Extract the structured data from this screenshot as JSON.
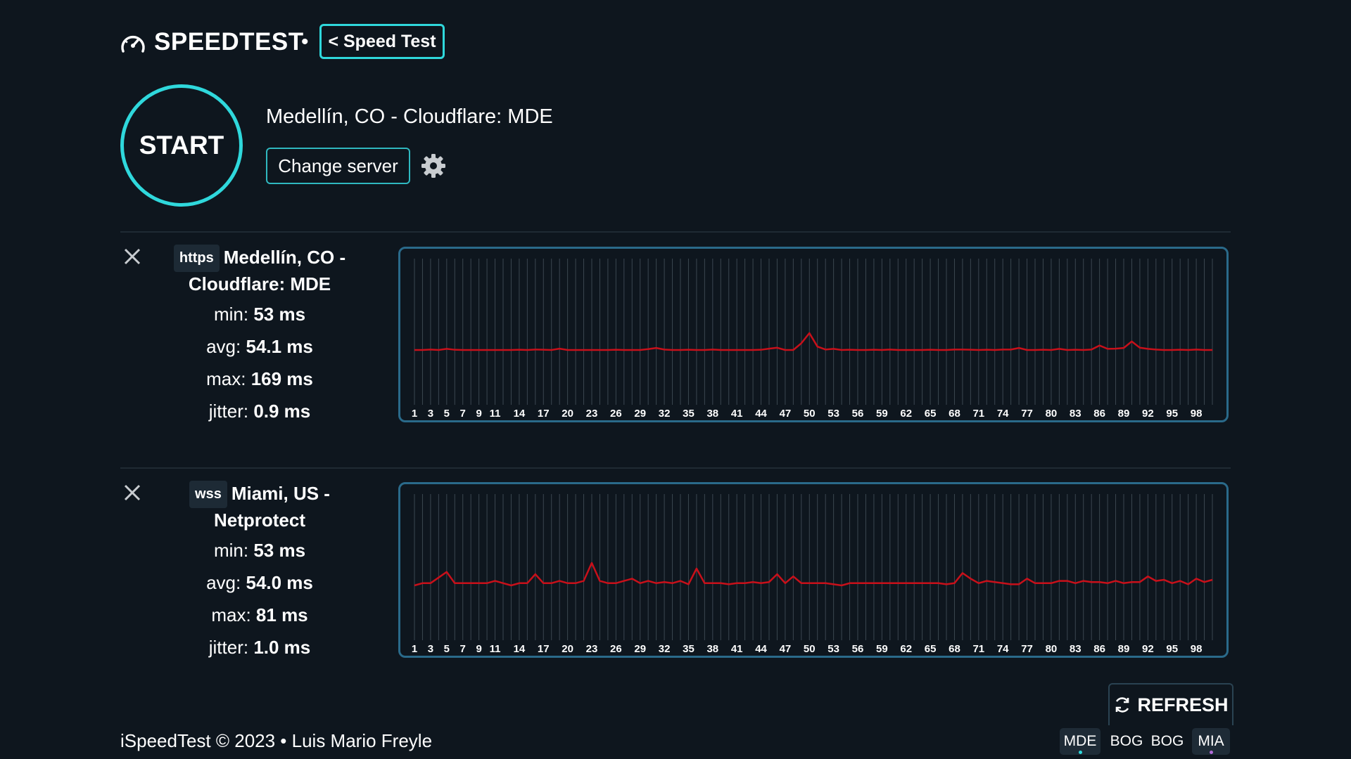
{
  "header": {
    "logo_text": "SPEEDTEST",
    "separator": "•",
    "back_button": "< Speed Test"
  },
  "start": {
    "label": "START",
    "server_name": "Medellín, CO - Cloudflare: MDE",
    "change_server": "Change server"
  },
  "results": [
    {
      "protocol": "https",
      "title": "Medellín, CO - Cloudflare: MDE",
      "title_line1": "Medellín, CO -",
      "title_line2": "Cloudflare: MDE",
      "min_label": "min:",
      "min_value": "53 ms",
      "avg_label": "avg:",
      "avg_value": "54.1 ms",
      "max_label": "max:",
      "max_value": "169 ms",
      "jitter_label": "jitter:",
      "jitter_value": "0.9 ms"
    },
    {
      "protocol": "wss",
      "title": "Miami, US - Netprotect",
      "title_line1": "Miami, US -",
      "title_line2": "Netprotect",
      "min_label": "min:",
      "min_value": "53 ms",
      "avg_label": "avg:",
      "avg_value": "54.0 ms",
      "max_label": "max:",
      "max_value": "81 ms",
      "jitter_label": "jitter:",
      "jitter_value": "1.0 ms"
    }
  ],
  "chart_data": [
    {
      "type": "line",
      "x_tick_labels": [
        "1",
        "3",
        "5",
        "7",
        "9",
        "11",
        "14",
        "17",
        "20",
        "23",
        "26",
        "29",
        "32",
        "35",
        "38",
        "41",
        "44",
        "47",
        "50",
        "53",
        "56",
        "59",
        "62",
        "65",
        "68",
        "71",
        "74",
        "77",
        "80",
        "83",
        "86",
        "89",
        "92",
        "95",
        "98"
      ],
      "x": [
        1,
        2,
        3,
        4,
        5,
        6,
        7,
        8,
        9,
        10,
        11,
        12,
        13,
        14,
        15,
        16,
        17,
        18,
        19,
        20,
        21,
        22,
        23,
        24,
        25,
        26,
        27,
        28,
        29,
        30,
        31,
        32,
        33,
        34,
        35,
        36,
        37,
        38,
        39,
        40,
        41,
        42,
        43,
        44,
        45,
        46,
        47,
        48,
        49,
        50,
        51,
        52,
        53,
        54,
        55,
        56,
        57,
        58,
        59,
        60,
        61,
        62,
        63,
        64,
        65,
        66,
        67,
        68,
        69,
        70,
        71,
        72,
        73,
        74,
        75,
        76,
        77,
        78,
        79,
        80,
        81,
        82,
        83,
        84,
        85,
        86,
        87,
        88,
        89,
        90,
        91,
        92,
        93,
        94,
        95,
        96,
        97,
        98,
        99,
        100
      ],
      "series": [
        {
          "color": "#c8101a",
          "values": [
            53,
            53,
            53.2,
            53,
            53.5,
            53.1,
            53,
            53,
            53,
            53,
            53,
            53,
            53,
            53.1,
            53,
            53.2,
            53.1,
            53,
            53.6,
            53,
            53,
            53,
            53,
            53,
            53,
            53.1,
            53,
            53,
            53,
            53.4,
            53.9,
            53.2,
            53,
            53,
            53.1,
            53,
            53,
            53.2,
            53,
            53,
            53,
            53,
            53,
            53.1,
            53.6,
            54,
            53,
            53,
            56,
            60.5,
            54.5,
            53.2,
            53.5,
            53,
            53.1,
            53,
            53,
            53.1,
            53,
            53.2,
            53,
            53,
            53,
            53,
            53.1,
            53,
            53,
            53.2,
            53.2,
            53.1,
            53,
            53.1,
            53,
            53.2,
            53.2,
            53.9,
            53,
            53,
            53.1,
            53,
            53.5,
            53,
            53.1,
            53,
            53.2,
            55,
            53.5,
            53.6,
            53.9,
            56.8,
            54,
            53.5,
            53.2,
            53,
            53,
            53.1,
            53,
            53.2,
            53,
            53
          ]
        }
      ]
    },
    {
      "type": "line",
      "x_tick_labels": [
        "1",
        "3",
        "5",
        "7",
        "9",
        "11",
        "14",
        "17",
        "20",
        "23",
        "26",
        "29",
        "32",
        "35",
        "38",
        "41",
        "44",
        "47",
        "50",
        "53",
        "56",
        "59",
        "62",
        "65",
        "68",
        "71",
        "74",
        "77",
        "80",
        "83",
        "86",
        "89",
        "92",
        "95",
        "98"
      ],
      "x": [
        1,
        2,
        3,
        4,
        5,
        6,
        7,
        8,
        9,
        10,
        11,
        12,
        13,
        14,
        15,
        16,
        17,
        18,
        19,
        20,
        21,
        22,
        23,
        24,
        25,
        26,
        27,
        28,
        29,
        30,
        31,
        32,
        33,
        34,
        35,
        36,
        37,
        38,
        39,
        40,
        41,
        42,
        43,
        44,
        45,
        46,
        47,
        48,
        49,
        50,
        51,
        52,
        53,
        54,
        55,
        56,
        57,
        58,
        59,
        60,
        61,
        62,
        63,
        64,
        65,
        66,
        67,
        68,
        69,
        70,
        71,
        72,
        73,
        74,
        75,
        76,
        77,
        78,
        79,
        80,
        81,
        82,
        83,
        84,
        85,
        86,
        87,
        88,
        89,
        90,
        91,
        92,
        93,
        94,
        95,
        96,
        97,
        98,
        99,
        100
      ],
      "series": [
        {
          "color": "#c8101a",
          "values": [
            53,
            54,
            54,
            56.5,
            59,
            54,
            54,
            54,
            54,
            54,
            55,
            54,
            53,
            54,
            54,
            58,
            54,
            54,
            55,
            54,
            54,
            55,
            63,
            55,
            54,
            54,
            55,
            56,
            54,
            55,
            54,
            54.5,
            54,
            55,
            53.5,
            60.5,
            54,
            54,
            54,
            53.5,
            54,
            54,
            54.5,
            54,
            54.5,
            58,
            54,
            57,
            54,
            54,
            54,
            54,
            53.5,
            53,
            54,
            54,
            54,
            54,
            54,
            54,
            54,
            54,
            54,
            54,
            54,
            54,
            53.5,
            54,
            58.5,
            56,
            54,
            55,
            54.5,
            54,
            53.5,
            53.5,
            56,
            54,
            54,
            54,
            55,
            55,
            54,
            55,
            54.5,
            54.5,
            54,
            55,
            54,
            54.5,
            54.5,
            57,
            55,
            55.5,
            54,
            55,
            53.5,
            56,
            54.5,
            55.5
          ]
        }
      ]
    }
  ],
  "footer": {
    "refresh": "REFRESH",
    "copyright": "iSpeedTest © 2023 • Luis Mario Freyle",
    "servers": [
      {
        "code": "MDE",
        "active": true,
        "dot_color": "#2fd8dc"
      },
      {
        "code": "BOG",
        "active": false
      },
      {
        "code": "BOG",
        "active": false
      },
      {
        "code": "MIA",
        "active": true,
        "dot_color": "#b26bd9"
      }
    ]
  }
}
